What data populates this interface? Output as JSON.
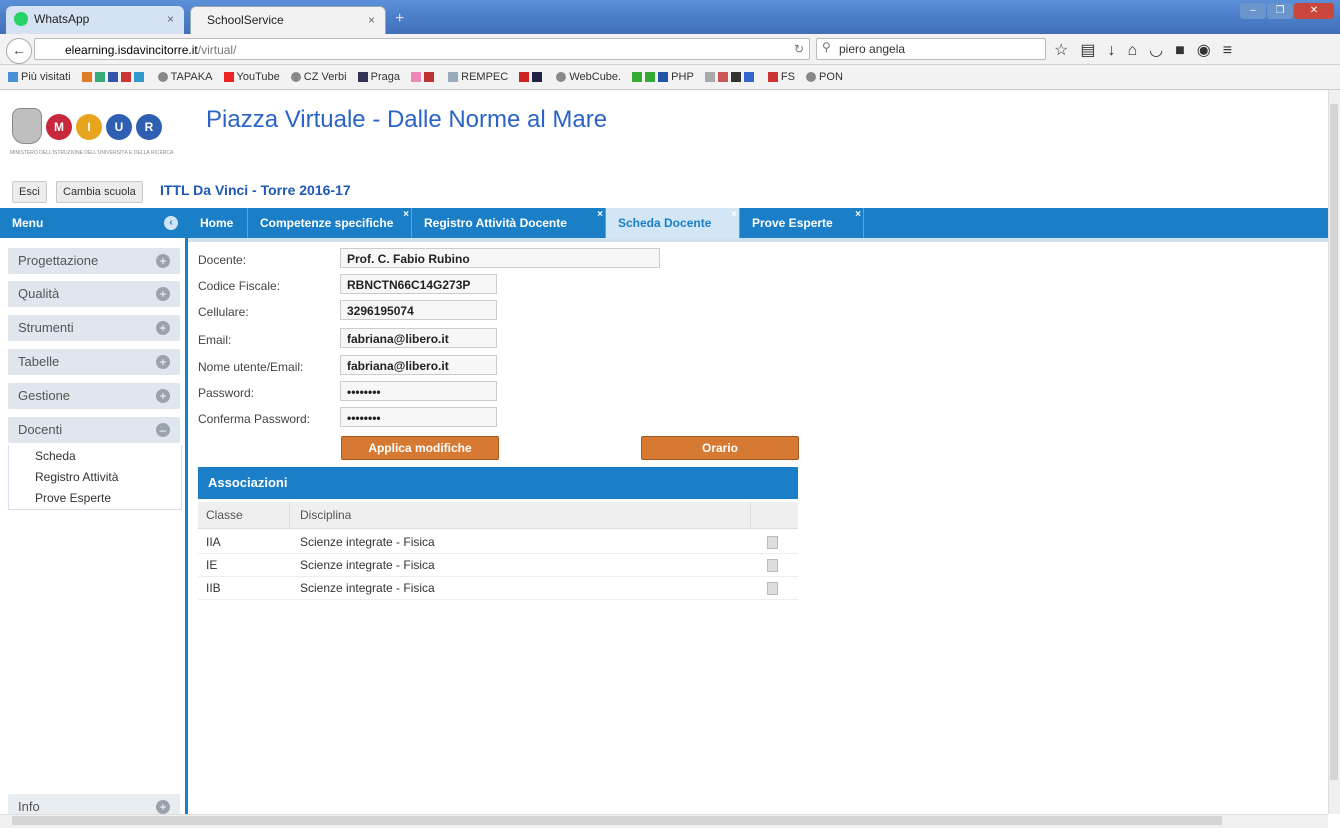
{
  "browser": {
    "tabs": [
      {
        "label": "WhatsApp"
      },
      {
        "label": "SchoolService"
      }
    ],
    "url_host": "elearning.isdavincitorre.it",
    "url_path": "/virtual/",
    "search_value": "piero angela",
    "bookmarks": [
      "Più visitati",
      "TAPAKA",
      "YouTube",
      "CZ Verbi",
      "Praga",
      "REMPEC",
      "WebCube.",
      "PHP",
      "FS",
      "PON"
    ]
  },
  "page": {
    "title": "Piazza Virtuale - Dalle Norme al Mare",
    "ministero_text": "MINISTERO DELL'ISTRUZIONE DELL'UNIVERSITÀ E DELLA RICERCA",
    "miur_letters": [
      "M",
      "I",
      "U",
      "R"
    ],
    "esci_label": "Esci",
    "cambia_scuola_label": "Cambia scuola",
    "school_name": "ITTL Da Vinci - Torre 2016-17"
  },
  "menu": {
    "header": "Menu",
    "items": [
      {
        "label": "Progettazione"
      },
      {
        "label": "Qualità"
      },
      {
        "label": "Strumenti"
      },
      {
        "label": "Tabelle"
      },
      {
        "label": "Gestione"
      },
      {
        "label": "Docenti"
      }
    ],
    "docenti_sub": [
      "Scheda",
      "Registro Attività",
      "Prove Esperte"
    ],
    "info_label": "Info"
  },
  "content_tabs": [
    {
      "label": "Home"
    },
    {
      "label": "Competenze specifiche"
    },
    {
      "label": "Registro Attività Docente"
    },
    {
      "label": "Scheda Docente"
    },
    {
      "label": "Prove Esperte"
    }
  ],
  "form": {
    "docente_label": "Docente:",
    "docente_value": "Prof. C. Fabio Rubino",
    "cf_label": "Codice Fiscale:",
    "cf_value": "RBNCTN66C14G273P",
    "cell_label": "Cellulare:",
    "cell_value": "3296195074",
    "email_label": "Email:",
    "email_value": "fabriana@libero.it",
    "user_label": "Nome utente/Email:",
    "user_value": "fabriana@libero.it",
    "pwd_label": "Password:",
    "pwd_value": "••••••••",
    "pwd2_label": "Conferma Password:",
    "pwd2_value": "••••••••",
    "apply_label": "Applica modifiche",
    "orario_label": "Orario"
  },
  "associazioni": {
    "title": "Associazioni",
    "columns": [
      "Classe",
      "Disciplina"
    ],
    "rows": [
      {
        "classe": "IIA",
        "disciplina": "Scienze integrate - Fisica"
      },
      {
        "classe": "IE",
        "disciplina": "Scienze integrate - Fisica"
      },
      {
        "classe": "IIB",
        "disciplina": "Scienze integrate - Fisica"
      }
    ]
  },
  "colors": {
    "accent": "#1b7fc8",
    "button": "#d67a33",
    "title": "#2a64c8"
  }
}
